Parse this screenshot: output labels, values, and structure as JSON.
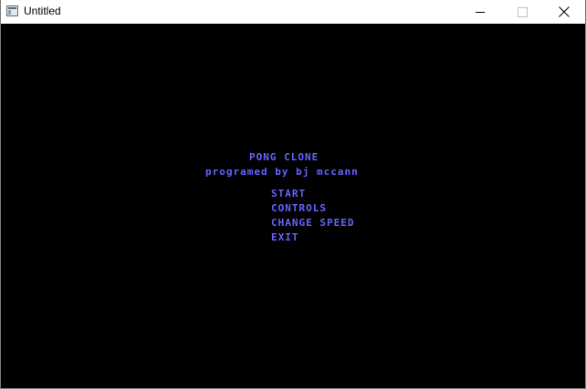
{
  "window": {
    "title": "Untitled",
    "icons": {
      "app": "app-window-icon",
      "minimize": "minimize-icon",
      "maximize": "maximize-icon",
      "close": "close-icon"
    }
  },
  "game": {
    "title": "PONG CLONE",
    "credit": "programed by bj mccann",
    "menu": {
      "start": "START",
      "controls": "CONTROLS",
      "change_speed": "CHANGE SPEED",
      "exit": "EXIT"
    }
  },
  "colors": {
    "background": "#000000",
    "text": "#6464ff",
    "titlebar": "#ffffff"
  }
}
